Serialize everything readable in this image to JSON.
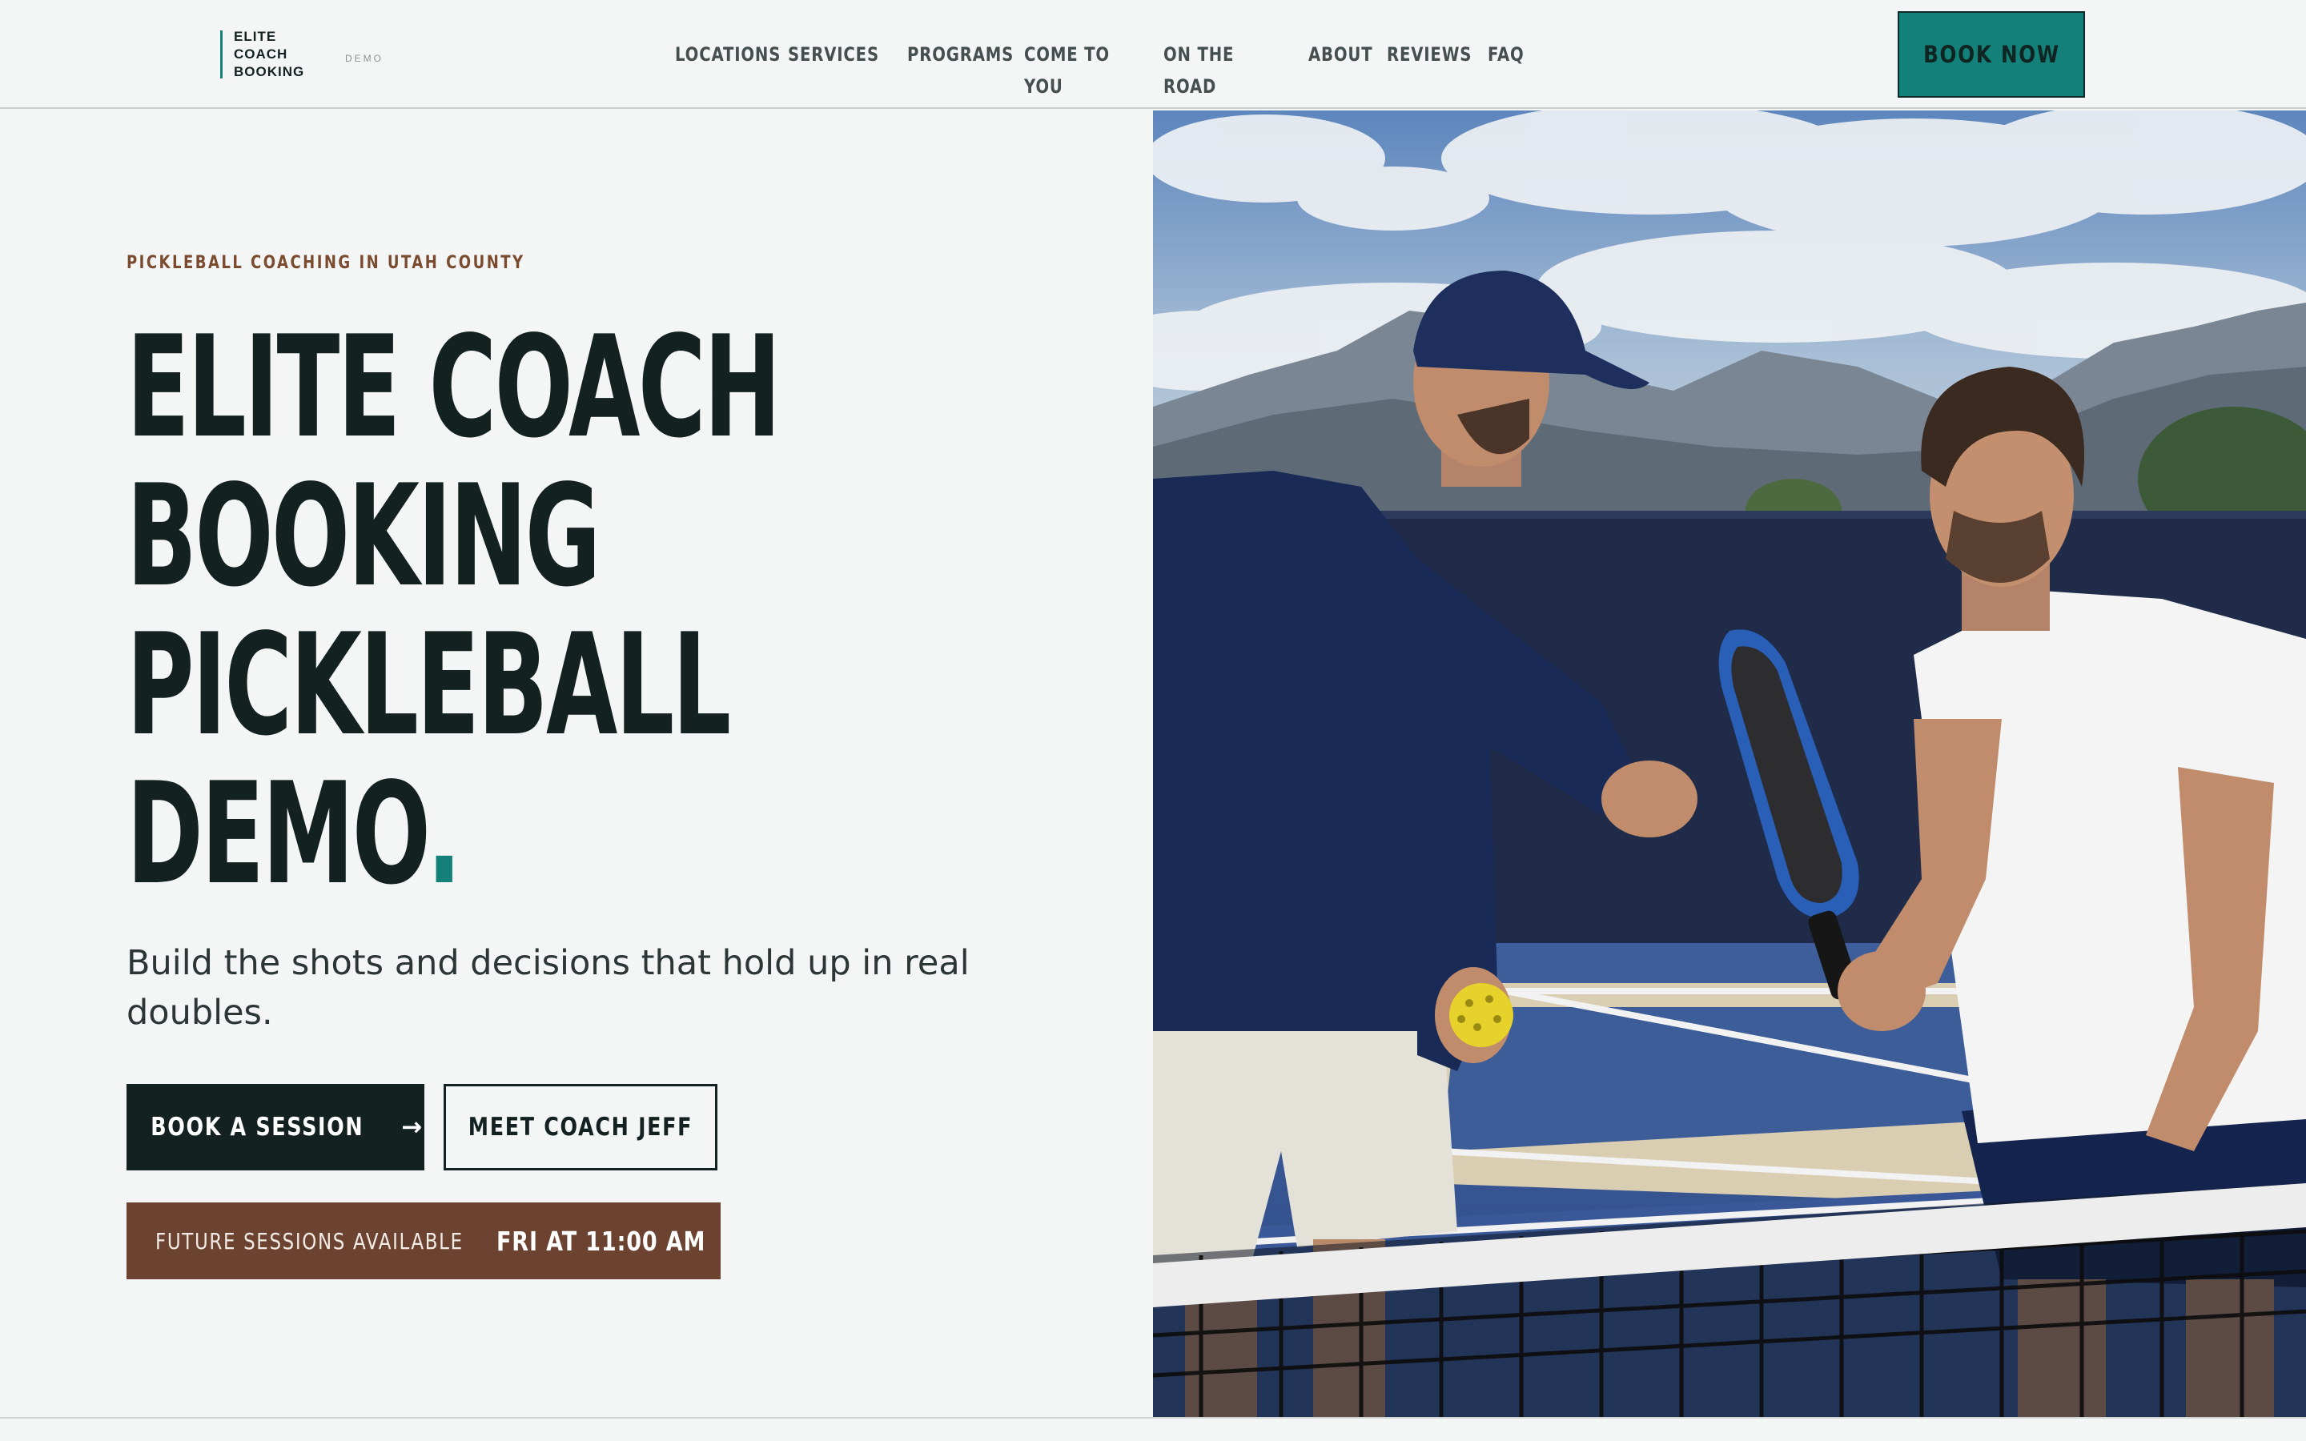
{
  "header": {
    "brand_lines": [
      "ELITE",
      "COACH",
      "BOOKING"
    ],
    "brand_tag": "DEMO",
    "nav": [
      "LOCATIONS",
      "SERVICES",
      "PROGRAMS",
      "COME TO YOU",
      "ON THE ROAD",
      "ABOUT",
      "REVIEWS",
      "FAQ"
    ],
    "cta": "BOOK NOW"
  },
  "hero": {
    "eyebrow": "PICKLEBALL COACHING IN UTAH COUNTY",
    "title_lines": [
      "ELITE COACH",
      "BOOKING",
      "PICKLEBALL",
      "DEMO"
    ],
    "title_dot": ".",
    "lede": "Build the shots and decisions that hold up in real doubles.",
    "primary_cta": "BOOK A SESSION",
    "primary_cta_arrow": "→",
    "secondary_cta": "MEET COACH JEFF",
    "sessions_label": "FUTURE SESSIONS AVAILABLE",
    "sessions_next": "FRI AT 11:00 AM"
  },
  "colors": {
    "accent": "#13807a",
    "dark": "#132220",
    "brown": "#6b4330",
    "eyebrow": "#7a4b2f",
    "background": "#f4f6f5"
  },
  "photo": {
    "icon": "hero-photo-coach-and-player"
  }
}
